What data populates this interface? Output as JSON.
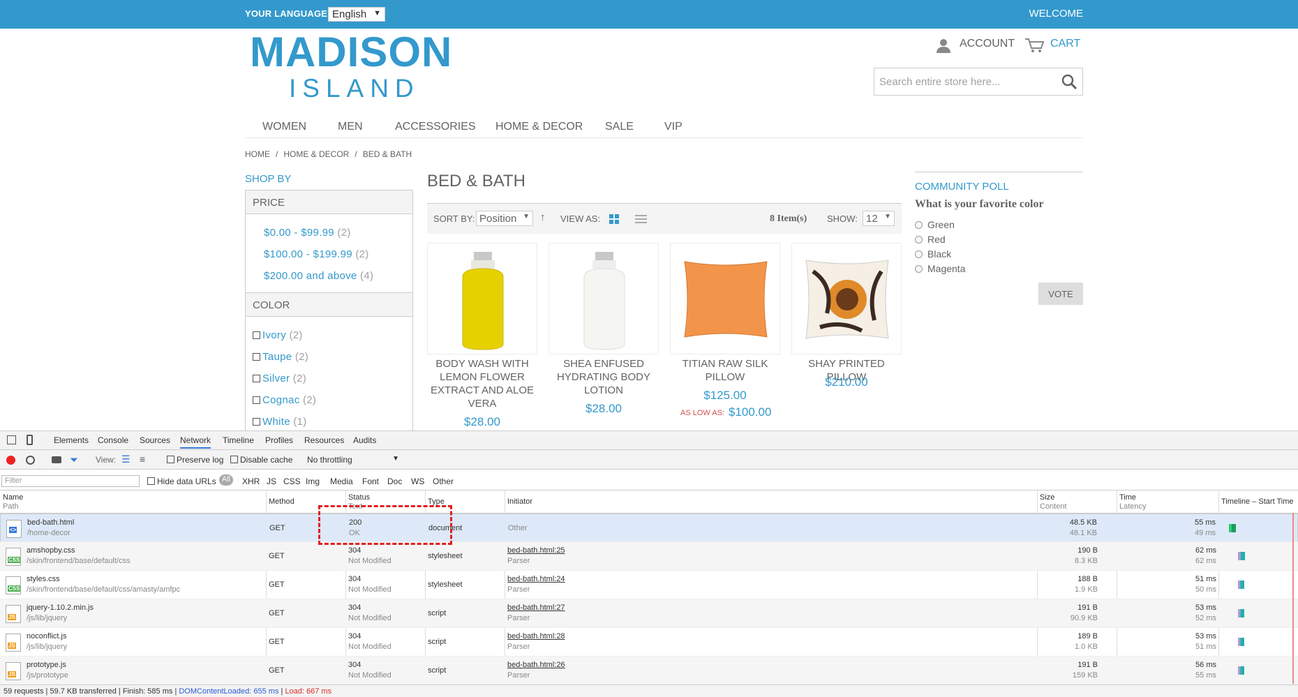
{
  "store": {
    "language_label": "YOUR LANGUAGE:",
    "language_value": "English",
    "welcome": "WELCOME",
    "logo_line1": "MADISON",
    "logo_line2": "ISLAND",
    "account": "ACCOUNT",
    "cart": "CART",
    "search_placeholder": "Search entire store here...",
    "nav": [
      "WOMEN",
      "MEN",
      "ACCESSORIES",
      "HOME & DECOR",
      "SALE",
      "VIP"
    ],
    "breadcrumbs": [
      "HOME",
      "HOME & DECOR",
      "BED & BATH"
    ],
    "shop_by": "SHOP BY",
    "price_heading": "PRICE",
    "price_filters": [
      {
        "label": "$0.00 - $99.99",
        "count": "(2)"
      },
      {
        "label": "$100.00 - $199.99",
        "count": "(2)"
      },
      {
        "label": "$200.00 and above",
        "count": "(4)"
      }
    ],
    "color_heading": "COLOR",
    "color_filters": [
      {
        "label": "Ivory",
        "count": "(2)"
      },
      {
        "label": "Taupe",
        "count": "(2)"
      },
      {
        "label": "Silver",
        "count": "(2)"
      },
      {
        "label": "Cognac",
        "count": "(2)"
      },
      {
        "label": "White",
        "count": "(1)"
      }
    ],
    "category_title": "BED & BATH",
    "sort_by_label": "SORT BY:",
    "sort_by_value": "Position",
    "view_as_label": "VIEW AS:",
    "item_count": "8 Item(s)",
    "show_label": "SHOW:",
    "show_value": "12",
    "products": [
      {
        "name_lines": [
          "BODY WASH WITH",
          "LEMON FLOWER",
          "EXTRACT AND ALOE",
          "VERA"
        ],
        "price": "$28.00"
      },
      {
        "name_lines": [
          "SHEA ENFUSED",
          "HYDRATING BODY",
          "LOTION"
        ],
        "price": "$28.00"
      },
      {
        "name_lines": [
          "TITIAN RAW SILK",
          "PILLOW"
        ],
        "price": "$125.00",
        "as_low_as": "AS LOW AS:",
        "low_price": "$100.00"
      },
      {
        "name_lines": [
          "SHAY PRINTED PILLOW"
        ],
        "price": "$210.00"
      }
    ],
    "poll": {
      "title": "COMMUNITY POLL",
      "question": "What is your favorite color",
      "options": [
        "Green",
        "Red",
        "Black",
        "Magenta"
      ],
      "vote": "VOTE"
    }
  },
  "devtools": {
    "tabs": [
      "Elements",
      "Console",
      "Sources",
      "Network",
      "Timeline",
      "Profiles",
      "Resources",
      "Audits"
    ],
    "active_tab": "Network",
    "view_label": "View:",
    "preserve_log": "Preserve log",
    "disable_cache": "Disable cache",
    "throttling": "No throttling",
    "filter_placeholder": "Filter",
    "hide_data_urls": "Hide data URLs",
    "type_filters": [
      "All",
      "XHR",
      "JS",
      "CSS",
      "Img",
      "Media",
      "Font",
      "Doc",
      "WS",
      "Other"
    ],
    "columns": {
      "name": "Name",
      "name_sub": "Path",
      "method": "Method",
      "status": "Status",
      "status_sub": "Text",
      "type": "Type",
      "initiator": "Initiator",
      "size": "Size",
      "size_sub": "Content",
      "time": "Time",
      "time_sub": "Latency",
      "timeline": "Timeline – Start Time"
    },
    "requests": [
      {
        "icon": "html-file-icon",
        "name": "bed-bath.html",
        "path": "/home-decor",
        "method": "GET",
        "status": "200",
        "status_text": "OK",
        "type": "document",
        "initiator": "Other",
        "initiator_sub": "",
        "size": "48.5 KB",
        "content": "48.1 KB",
        "time": "55 ms",
        "latency": "49 ms"
      },
      {
        "icon": "css-file-icon",
        "name": "amshopby.css",
        "path": "/skin/frontend/base/default/css",
        "method": "GET",
        "status": "304",
        "status_text": "Not Modified",
        "type": "stylesheet",
        "initiator": "bed-bath.html:25",
        "initiator_sub": "Parser",
        "size": "190 B",
        "content": "8.3 KB",
        "time": "62 ms",
        "latency": "62 ms"
      },
      {
        "icon": "css-file-icon",
        "name": "styles.css",
        "path": "/skin/frontend/base/default/css/amasty/amfpc",
        "method": "GET",
        "status": "304",
        "status_text": "Not Modified",
        "type": "stylesheet",
        "initiator": "bed-bath.html:24",
        "initiator_sub": "Parser",
        "size": "188 B",
        "content": "1.9 KB",
        "time": "51 ms",
        "latency": "50 ms"
      },
      {
        "icon": "js-file-icon",
        "name": "jquery-1.10.2.min.js",
        "path": "/js/lib/jquery",
        "method": "GET",
        "status": "304",
        "status_text": "Not Modified",
        "type": "script",
        "initiator": "bed-bath.html:27",
        "initiator_sub": "Parser",
        "size": "191 B",
        "content": "90.9 KB",
        "time": "53 ms",
        "latency": "52 ms"
      },
      {
        "icon": "js-file-icon",
        "name": "noconflict.js",
        "path": "/js/lib/jquery",
        "method": "GET",
        "status": "304",
        "status_text": "Not Modified",
        "type": "script",
        "initiator": "bed-bath.html:28",
        "initiator_sub": "Parser",
        "size": "189 B",
        "content": "1.0 KB",
        "time": "53 ms",
        "latency": "51 ms"
      },
      {
        "icon": "js-file-icon",
        "name": "prototype.js",
        "path": "/js/prototype",
        "method": "GET",
        "status": "304",
        "status_text": "Not Modified",
        "type": "script",
        "initiator": "bed-bath.html:26",
        "initiator_sub": "Parser",
        "size": "191 B",
        "content": "159 KB",
        "time": "56 ms",
        "latency": "55 ms"
      }
    ],
    "status": {
      "requests": "59 requests",
      "transferred": "59.7 KB transferred",
      "finish": "Finish: 585 ms",
      "dcl": "DOMContentLoaded: 655 ms",
      "load": "Load: 667 ms"
    },
    "colors": {
      "dcl": "#2a5bd7",
      "load": "#d93025",
      "accent": "#3399cc"
    }
  }
}
